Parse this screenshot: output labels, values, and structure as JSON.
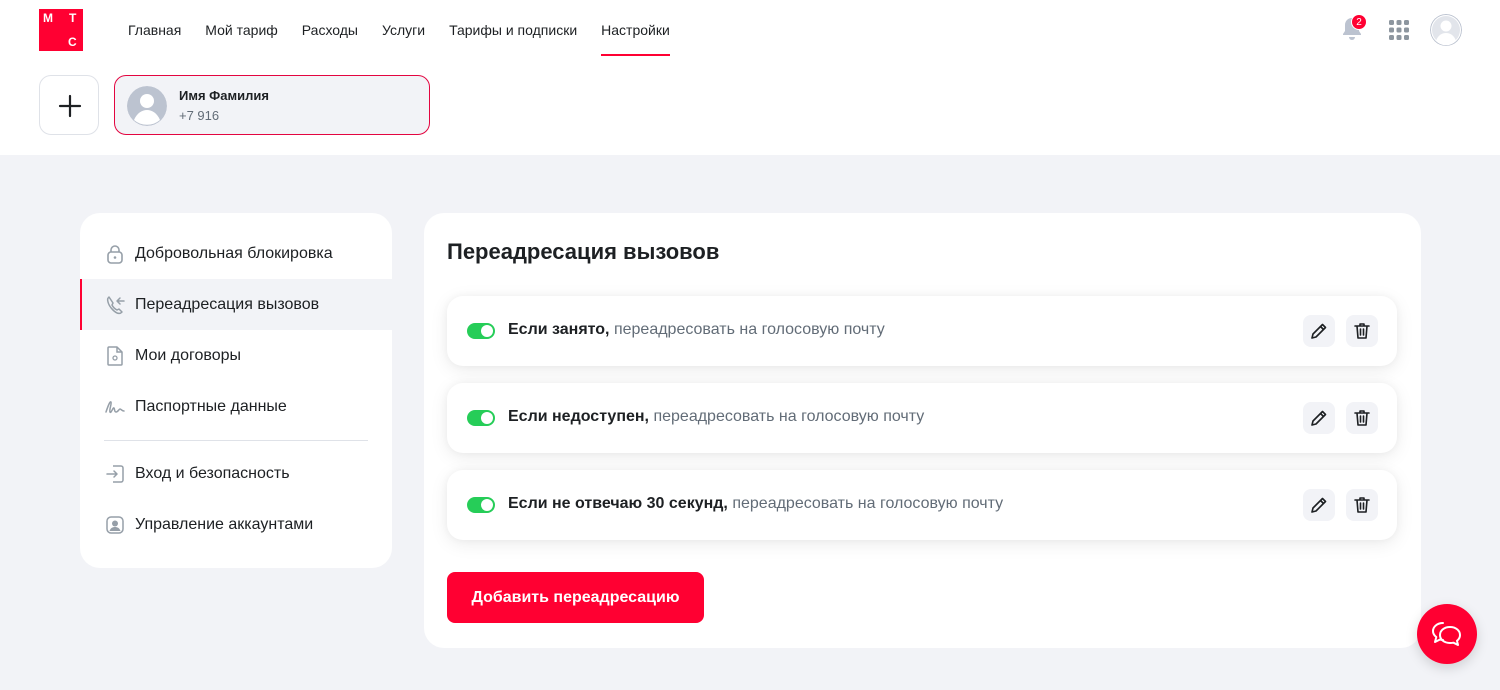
{
  "header": {
    "logo_letters": [
      "М",
      "Т",
      "С"
    ],
    "nav": [
      {
        "label": "Главная",
        "active": false
      },
      {
        "label": "Мой тариф",
        "active": false
      },
      {
        "label": "Расходы",
        "active": false
      },
      {
        "label": "Услуги",
        "active": false
      },
      {
        "label": "Тарифы и подписки",
        "active": false
      },
      {
        "label": "Настройки",
        "active": true
      }
    ],
    "notifications_count": "2",
    "icons": [
      "bell-icon",
      "apps-grid-icon",
      "avatar"
    ]
  },
  "accounts": {
    "add_icon": "plus-icon",
    "current": {
      "name": "Имя Фамилия",
      "phone": "+7 916"
    }
  },
  "sidebar": {
    "items": [
      {
        "label": "Добровольная блокировка",
        "icon": "lock-icon",
        "active": false
      },
      {
        "label": "Переадресация вызовов",
        "icon": "call-forward-icon",
        "active": true
      },
      {
        "label": "Мои договоры",
        "icon": "document-icon",
        "active": false
      },
      {
        "label": "Паспортные данные",
        "icon": "signature-icon",
        "active": false
      },
      {
        "label": "Вход и безопасность",
        "icon": "login-icon",
        "active": false
      },
      {
        "label": "Управление аккаунтами",
        "icon": "account-icon",
        "active": false
      }
    ]
  },
  "main": {
    "title": "Переадресация вызовов",
    "rules": [
      {
        "condition": "Если занято,",
        "action": "переадресовать на голосовую почту",
        "enabled": true
      },
      {
        "condition": "Если недоступен,",
        "action": "переадресовать на голосовую почту",
        "enabled": true
      },
      {
        "condition": "Если не отвечаю 30 секунд,",
        "action": "переадресовать на голосовую почту",
        "enabled": true
      }
    ],
    "add_button_label": "Добавить переадресацию"
  },
  "colors": {
    "brand_red": "#ff0032",
    "toggle_on": "#26cd58",
    "background": "#f2f3f7",
    "text_primary": "#1d2023",
    "text_secondary": "#626c77"
  },
  "chat_icon": "chat-bubbles-icon"
}
